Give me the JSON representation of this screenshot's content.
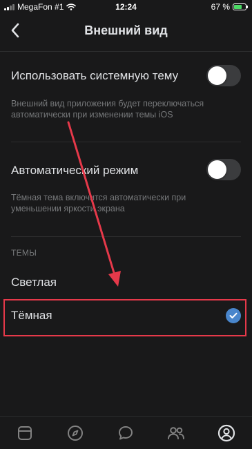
{
  "status_bar": {
    "carrier": "MegaFon #1",
    "time": "12:24",
    "battery_text": "67 %",
    "battery_level": 0.67
  },
  "nav": {
    "title": "Внешний вид",
    "back_icon": "chevron-left-icon"
  },
  "settings": {
    "system_theme": {
      "label": "Использовать системную тему",
      "hint": "Внешний вид приложения будет переключаться автоматически при изменении темы iOS",
      "enabled": false
    },
    "auto_mode": {
      "label": "Автоматический режим",
      "hint": "Тёмная тема включится автоматически при уменьшении яркости экрана",
      "enabled": false
    }
  },
  "themes": {
    "header": "ТЕМЫ",
    "options": [
      {
        "label": "Светлая",
        "selected": false
      },
      {
        "label": "Тёмная",
        "selected": true
      }
    ]
  },
  "tab_bar": {
    "tabs": [
      {
        "icon": "news-feed-icon",
        "active": false
      },
      {
        "icon": "compass-icon",
        "active": false
      },
      {
        "icon": "messages-icon",
        "active": false
      },
      {
        "icon": "friends-icon",
        "active": false
      },
      {
        "icon": "profile-icon",
        "active": true
      }
    ]
  },
  "colors": {
    "background": "#19191a",
    "text_primary": "#e1e3e6",
    "text_secondary": "#76787a",
    "accent": "#4986cc",
    "annotation": "#e6394a",
    "battery": "#4bd964"
  }
}
